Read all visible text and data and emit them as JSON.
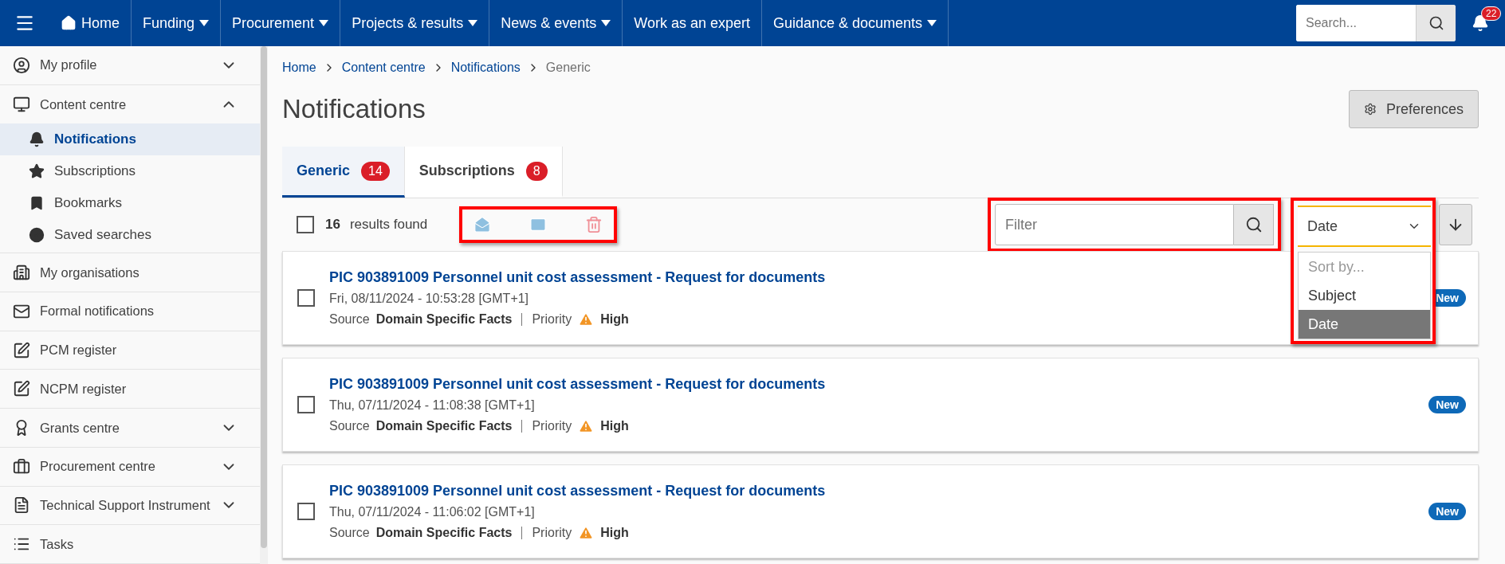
{
  "nav": {
    "items": [
      {
        "label": "Home",
        "kind": "home"
      },
      {
        "label": "Funding",
        "kind": "dropdown"
      },
      {
        "label": "Procurement",
        "kind": "dropdown"
      },
      {
        "label": "Projects & results",
        "kind": "dropdown"
      },
      {
        "label": "News & events",
        "kind": "dropdown"
      },
      {
        "label": "Work as an expert",
        "kind": "link"
      },
      {
        "label": "Guidance & documents",
        "kind": "dropdown"
      }
    ],
    "search": {
      "placeholder": "Search..."
    },
    "notification_count": "22"
  },
  "sidebar": {
    "items": [
      {
        "label": "My profile",
        "expanded": false
      },
      {
        "label": "Content centre",
        "expanded": true,
        "children": [
          {
            "label": "Notifications",
            "selected": true
          },
          {
            "label": "Subscriptions",
            "selected": false
          },
          {
            "label": "Bookmarks",
            "selected": false
          },
          {
            "label": "Saved searches",
            "selected": false
          }
        ]
      },
      {
        "label": "My organisations"
      },
      {
        "label": "Formal notifications"
      },
      {
        "label": "PCM register"
      },
      {
        "label": "NCPM register"
      },
      {
        "label": "Grants centre",
        "expanded": false
      },
      {
        "label": "Procurement centre",
        "expanded": false
      },
      {
        "label": "Technical Support Instrument",
        "expanded": false
      },
      {
        "label": "Tasks"
      }
    ]
  },
  "breadcrumb": [
    {
      "label": "Home",
      "kind": "link"
    },
    {
      "label": "Content centre",
      "kind": "link"
    },
    {
      "label": "Notifications",
      "kind": "link"
    },
    {
      "label": "Generic",
      "kind": "current"
    }
  ],
  "title": "Notifications",
  "preferences_button": "Preferences",
  "tabs": [
    {
      "label": "Generic",
      "count": "14",
      "selected": true
    },
    {
      "label": "Subscriptions",
      "count": "8",
      "selected": false
    }
  ],
  "toolbar": {
    "select_all_checked": false,
    "result_count": "16",
    "result_label": "results found",
    "filter": {
      "placeholder": "Filter"
    },
    "sort": {
      "value": "Date",
      "placeholder": "Sort by...",
      "options": [
        {
          "label": "Subject",
          "selected": false
        },
        {
          "label": "Date",
          "selected": true
        }
      ]
    }
  },
  "notifications": [
    {
      "title": "PIC 903891009 Personnel unit cost assessment - Request for documents",
      "date": "Fri, 08/11/2024 - 10:53:28 [GMT+1]",
      "source_label": "Source",
      "source": "Domain Specific Facts",
      "priority_label": "Priority",
      "priority": "High",
      "badge": "New",
      "checked": false
    },
    {
      "title": "PIC 903891009 Personnel unit cost assessment - Request for documents",
      "date": "Thu, 07/11/2024 - 11:08:38 [GMT+1]",
      "source_label": "Source",
      "source": "Domain Specific Facts",
      "priority_label": "Priority",
      "priority": "High",
      "badge": "New",
      "checked": false
    },
    {
      "title": "PIC 903891009 Personnel unit cost assessment - Request for documents",
      "date": "Thu, 07/11/2024 - 11:06:02 [GMT+1]",
      "source_label": "Source",
      "source": "Domain Specific Facts",
      "priority_label": "Priority",
      "priority": "High",
      "badge": "New",
      "checked": false
    }
  ]
}
